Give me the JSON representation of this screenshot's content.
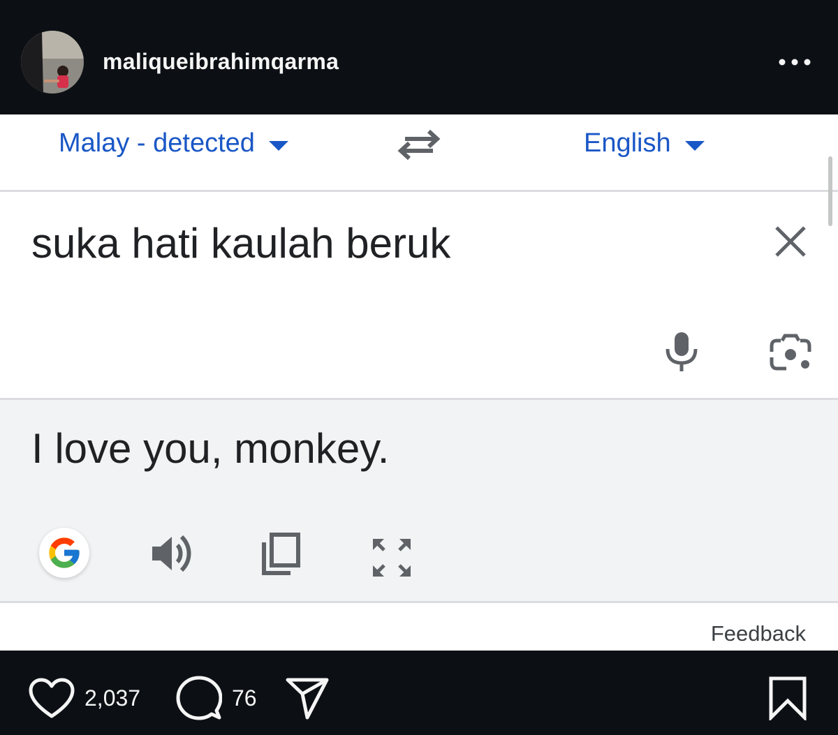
{
  "post": {
    "username": "maliqueibrahimqarma",
    "avatar_icon": "profile-photo-avatar",
    "more_icon": "more-horizontal-icon"
  },
  "translate": {
    "source_language": "Malay - detected",
    "target_language": "English",
    "source_text": "suka hati kaulah beruk",
    "translated_text": "I love you, monkey.",
    "feedback_label": "Feedback",
    "accent_color": "#1a57c6",
    "result_bg_color": "#f1f3f4",
    "icons": [
      "swap-languages-icon",
      "close-icon",
      "mic-icon",
      "camera-lens-icon",
      "google-logo-icon",
      "speaker-icon",
      "copy-icon",
      "fullscreen-icon"
    ]
  },
  "actions": {
    "likes": "2,037",
    "comments": "76",
    "icons": [
      "heart-icon",
      "comment-icon",
      "share-icon",
      "bookmark-icon"
    ]
  }
}
